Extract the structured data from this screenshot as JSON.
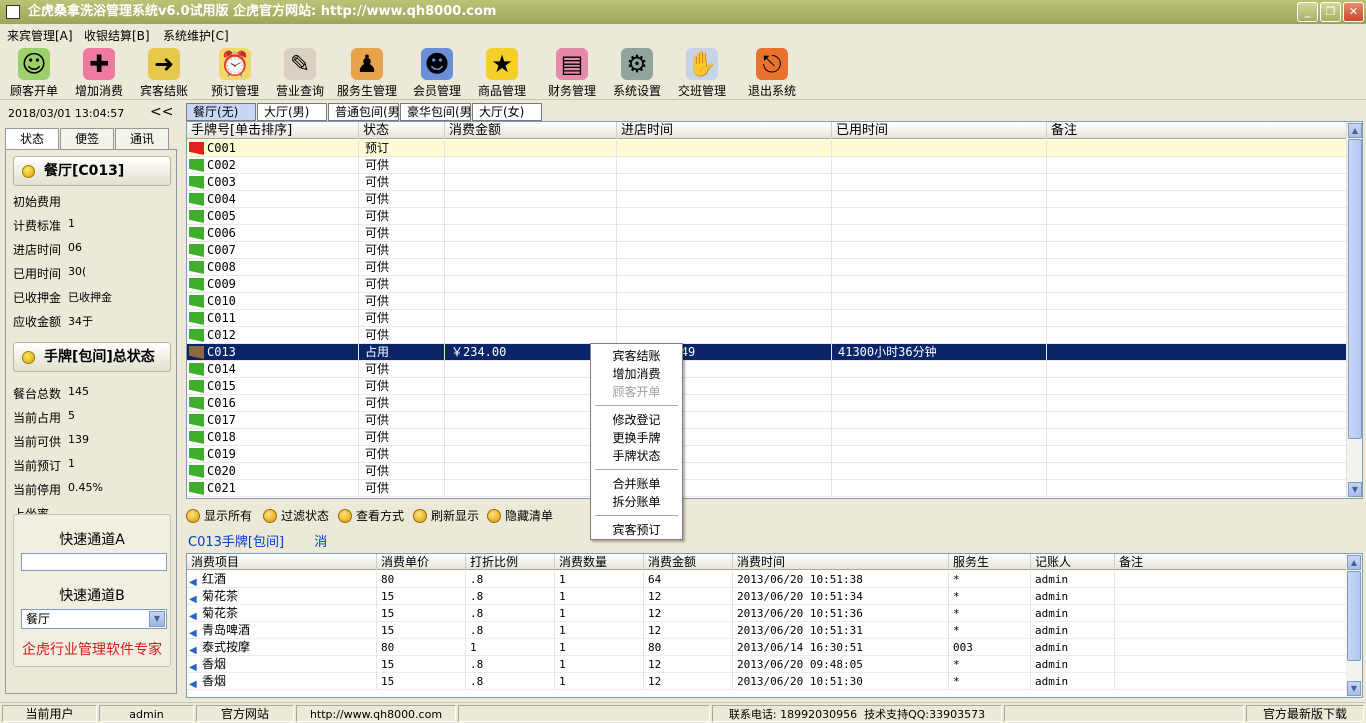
{
  "window": {
    "title": "企虎桑拿洗浴管理系统v6.0试用版   企虎官方网站: http://www.qh8000.com"
  },
  "menu": [
    "来宾管理[A]",
    "收银结算[B]",
    "系统维护[C]"
  ],
  "toolbar": [
    {
      "label": "顾客开单",
      "icon": "customer-icon"
    },
    {
      "label": "增加消费",
      "icon": "add-consume-icon"
    },
    {
      "label": "宾客结账",
      "icon": "checkout-icon"
    },
    {
      "label": "预订管理",
      "icon": "alarm-clock-icon"
    },
    {
      "label": "营业查询",
      "icon": "query-icon"
    },
    {
      "label": "服务生管理",
      "icon": "staff-icon"
    },
    {
      "label": "会员管理",
      "icon": "member-icon"
    },
    {
      "label": "商品管理",
      "icon": "star-icon"
    },
    {
      "label": "财务管理",
      "icon": "finance-icon"
    },
    {
      "label": "系统设置",
      "icon": "settings-icon"
    },
    {
      "label": "交班管理",
      "icon": "handshake-icon"
    },
    {
      "label": "退出系统",
      "icon": "exit-icon"
    }
  ],
  "left": {
    "datetime": "2018/03/01 13:04:57",
    "collapse": "<<",
    "tabs": [
      "状态",
      "便签",
      "通讯"
    ],
    "section1": "餐厅[C013]",
    "info": [
      {
        "k": "初始费用",
        "v": ""
      },
      {
        "k": "计费标准",
        "v": "1"
      },
      {
        "k": "进店时间",
        "v": "06"
      },
      {
        "k": "已用时间",
        "v": "30("
      },
      {
        "k": "已收押金",
        "v": "已收押金"
      },
      {
        "k": "应收金额",
        "v": "34于"
      }
    ],
    "section2": "手牌[包间]总状态",
    "stats": [
      {
        "k": "餐台总数",
        "v": "145"
      },
      {
        "k": "当前占用",
        "v": "5"
      },
      {
        "k": "当前可供",
        "v": "139"
      },
      {
        "k": "当前预订",
        "v": "1"
      },
      {
        "k": "当前停用",
        "v": "0.45%"
      },
      {
        "k": "上坐率",
        "v": ""
      }
    ],
    "quickA": "快速通道A",
    "quickB": "快速通道B",
    "quickB_value": "餐厅",
    "brand": "企虎行业管理软件专家"
  },
  "room_tabs": [
    "餐厅(无)",
    "大厅(男)",
    "普通包间(男",
    "豪华包间(男",
    "大厅(女)"
  ],
  "grid1": {
    "headers": [
      "手牌号[单击排序]",
      "状态",
      "消费金额",
      "进店时间",
      "已用时间",
      "备注"
    ],
    "rows": [
      {
        "no": "C001",
        "status": "预订",
        "amount": "",
        "intime": "",
        "used": "",
        "note": "",
        "flag": "red"
      },
      {
        "no": "C002",
        "status": "可供",
        "amount": "",
        "intime": "",
        "used": "",
        "note": "",
        "flag": "green"
      },
      {
        "no": "C003",
        "status": "可供",
        "amount": "",
        "intime": "",
        "used": "",
        "note": "",
        "flag": "green"
      },
      {
        "no": "C004",
        "status": "可供",
        "amount": "",
        "intime": "",
        "used": "",
        "note": "",
        "flag": "green"
      },
      {
        "no": "C005",
        "status": "可供",
        "amount": "",
        "intime": "",
        "used": "",
        "note": "",
        "flag": "green"
      },
      {
        "no": "C006",
        "status": "可供",
        "amount": "",
        "intime": "",
        "used": "",
        "note": "",
        "flag": "green"
      },
      {
        "no": "C007",
        "status": "可供",
        "amount": "",
        "intime": "",
        "used": "",
        "note": "",
        "flag": "green"
      },
      {
        "no": "C008",
        "status": "可供",
        "amount": "",
        "intime": "",
        "used": "",
        "note": "",
        "flag": "green"
      },
      {
        "no": "C009",
        "status": "可供",
        "amount": "",
        "intime": "",
        "used": "",
        "note": "",
        "flag": "green"
      },
      {
        "no": "C010",
        "status": "可供",
        "amount": "",
        "intime": "",
        "used": "",
        "note": "",
        "flag": "green"
      },
      {
        "no": "C011",
        "status": "可供",
        "amount": "",
        "intime": "",
        "used": "",
        "note": "",
        "flag": "green"
      },
      {
        "no": "C012",
        "status": "可供",
        "amount": "",
        "intime": "",
        "used": "",
        "note": "",
        "flag": "green"
      },
      {
        "no": "C013",
        "status": "占用",
        "amount": "￥234.00",
        "intime": "4 16:28:49",
        "used": "41300小时36分钟",
        "note": "",
        "flag": "brown"
      },
      {
        "no": "C014",
        "status": "可供",
        "amount": "",
        "intime": "",
        "used": "",
        "note": "",
        "flag": "green"
      },
      {
        "no": "C015",
        "status": "可供",
        "amount": "",
        "intime": "",
        "used": "",
        "note": "",
        "flag": "green"
      },
      {
        "no": "C016",
        "status": "可供",
        "amount": "",
        "intime": "",
        "used": "",
        "note": "",
        "flag": "green"
      },
      {
        "no": "C017",
        "status": "可供",
        "amount": "",
        "intime": "",
        "used": "",
        "note": "",
        "flag": "green"
      },
      {
        "no": "C018",
        "status": "可供",
        "amount": "",
        "intime": "",
        "used": "",
        "note": "",
        "flag": "green"
      },
      {
        "no": "C019",
        "status": "可供",
        "amount": "",
        "intime": "",
        "used": "",
        "note": "",
        "flag": "green"
      },
      {
        "no": "C020",
        "status": "可供",
        "amount": "",
        "intime": "",
        "used": "",
        "note": "",
        "flag": "green"
      },
      {
        "no": "C021",
        "status": "可供",
        "amount": "",
        "intime": "",
        "used": "",
        "note": "",
        "flag": "green"
      }
    ]
  },
  "actions": [
    "显示所有",
    "过滤状态",
    "查看方式",
    "刷新显示",
    "隐藏清单"
  ],
  "context_menu": [
    {
      "label": "宾客结账",
      "disabled": false
    },
    {
      "label": "增加消费",
      "disabled": false
    },
    {
      "label": "顾客开单",
      "disabled": true
    },
    {
      "sep": true
    },
    {
      "label": "修改登记",
      "disabled": false
    },
    {
      "label": "更换手牌",
      "disabled": false
    },
    {
      "label": "手牌状态",
      "disabled": false
    },
    {
      "sep": true
    },
    {
      "label": "合并账单",
      "disabled": false
    },
    {
      "label": "拆分账单",
      "disabled": false
    },
    {
      "sep": true
    },
    {
      "label": "宾客预订",
      "disabled": false
    }
  ],
  "detail": {
    "title": "C013手牌[包间]",
    "suffix": "消"
  },
  "grid2": {
    "headers": [
      "消费项目",
      "消费单价",
      "打折比例",
      "消费数量",
      "消费金额",
      "消费时间",
      "服务生",
      "记账人",
      "备注"
    ],
    "rows": [
      [
        "红酒",
        "80",
        ".8",
        "1",
        "64",
        "2013/06/20 10:51:38",
        "*",
        "admin",
        ""
      ],
      [
        "菊花茶",
        "15",
        ".8",
        "1",
        "12",
        "2013/06/20 10:51:34",
        "*",
        "admin",
        ""
      ],
      [
        "菊花茶",
        "15",
        ".8",
        "1",
        "12",
        "2013/06/20 10:51:36",
        "*",
        "admin",
        ""
      ],
      [
        "青岛啤酒",
        "15",
        ".8",
        "1",
        "12",
        "2013/06/20 10:51:31",
        "*",
        "admin",
        ""
      ],
      [
        "泰式按摩",
        "80",
        "1",
        "1",
        "80",
        "2013/06/14 16:30:51",
        "003",
        "admin",
        ""
      ],
      [
        "香烟",
        "15",
        ".8",
        "1",
        "12",
        "2013/06/20 09:48:05",
        "*",
        "admin",
        ""
      ],
      [
        "香烟",
        "15",
        ".8",
        "1",
        "12",
        "2013/06/20 10:51:30",
        "*",
        "admin",
        ""
      ]
    ]
  },
  "status": {
    "user_label": "当前用户",
    "user": "admin",
    "site_label": "官方网站",
    "site": "http://www.qh8000.com",
    "phone": "联系电话: 18992030956",
    "qq": "技术支持QQ:33903573",
    "download": "官方最新版下载"
  },
  "colors": {
    "selected_row": "#0a246a",
    "reserved_row": "#fdfcd3",
    "flag_green": "#3fae2a",
    "flag_red": "#e02020",
    "flag_brown": "#8a6a3a",
    "brand": "#d71a1a"
  }
}
